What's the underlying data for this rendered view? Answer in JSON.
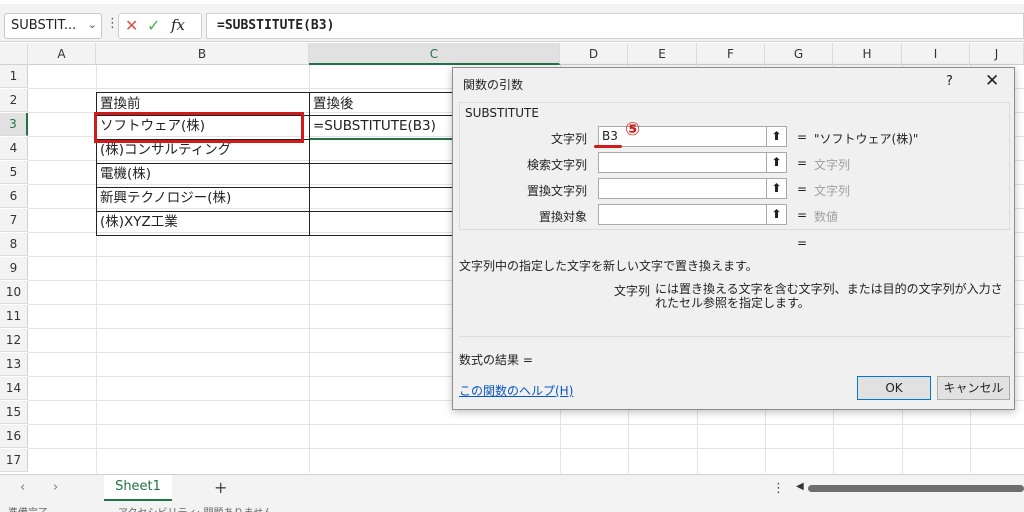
{
  "formula_bar": {
    "name_box": "SUBSTIT...",
    "dots": "⋮",
    "cancel_icon": "✕",
    "enter_icon": "✓",
    "fx_icon": "fx",
    "formula": "=SUBSTITUTE(B3)"
  },
  "columns": [
    "A",
    "B",
    "C",
    "D",
    "E",
    "F",
    "G",
    "H",
    "I",
    "J"
  ],
  "rows": [
    "1",
    "2",
    "3",
    "4",
    "5",
    "6",
    "7",
    "8",
    "9",
    "10",
    "11",
    "12",
    "13",
    "14",
    "15",
    "16",
    "17"
  ],
  "cells": {
    "b2": "置換前",
    "c2": "置換後",
    "b3": "ソフトウェア(株)",
    "c3": "=SUBSTITUTE(B3)",
    "b4": "(株)コンサルティング",
    "b5": "電機(株)",
    "b6": "新興テクノロジー(株)",
    "b7": "(株)XYZ工業"
  },
  "dialog": {
    "title": "関数の引数",
    "help": "?",
    "close": "✕",
    "function_name": "SUBSTITUTE",
    "args": [
      {
        "label": "文字列",
        "value": "B3",
        "eq": "=",
        "result": "\"ソフトウェア(株)\""
      },
      {
        "label": "検索文字列",
        "value": "",
        "eq": "=",
        "result": "文字列"
      },
      {
        "label": "置換文字列",
        "value": "",
        "eq": "=",
        "result": "文字列"
      },
      {
        "label": "置換対象",
        "value": "",
        "eq": "=",
        "result": "数値"
      }
    ],
    "collapse_icon": "⬆",
    "total_eq": "=",
    "description": "文字列中の指定した文字を新しい文字で置き換えます。",
    "arg_help_name": "文字列",
    "arg_help_text": "には置き換える文字を含む文字列、または目的の文字列が入力されたセル参照を指定します。",
    "result_label": "数式の結果 =",
    "help_link": "この関数のヘルプ(H)",
    "ok": "OK",
    "cancel": "キャンセル"
  },
  "annotation": {
    "step": "⑤",
    "accent_color": "#d11a1a"
  },
  "tabs": {
    "prev": "‹",
    "next": "›",
    "sheet": "Sheet1",
    "add": "+",
    "dots": "⋮",
    "scroll_left": "◀"
  },
  "status": {
    "text1": "準備完了",
    "text2": "アクセシビリティ: 問題ありません"
  }
}
